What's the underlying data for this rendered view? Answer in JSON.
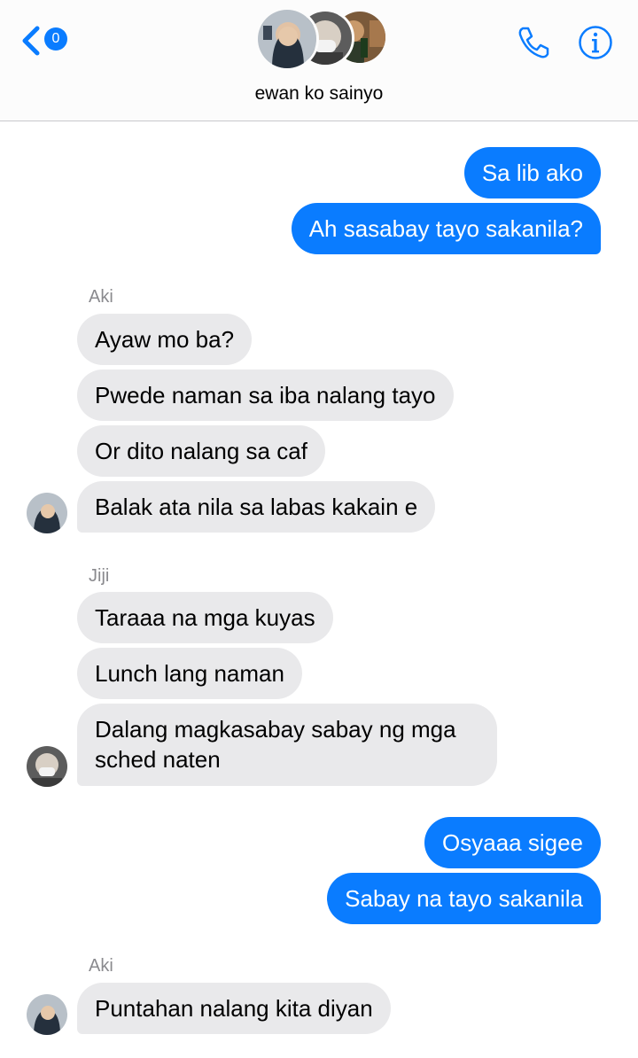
{
  "header": {
    "back_count": "0",
    "title": "ewan ko sainyo"
  },
  "messages": [
    {
      "text": "Sa lib ako"
    },
    {
      "text": "Ah sasabay tayo sakanila?"
    },
    {
      "sender": "Aki"
    },
    {
      "text": "Ayaw mo ba?"
    },
    {
      "text": "Pwede naman sa iba nalang tayo"
    },
    {
      "text": "Or dito nalang sa caf"
    },
    {
      "text": "Balak ata nila sa labas kakain e"
    },
    {
      "sender": "Jiji"
    },
    {
      "text": "Taraaa na mga kuyas"
    },
    {
      "text": "Lunch lang naman"
    },
    {
      "text_line1": "Dalang magkasabay sabay ng mga",
      "text_line2": "sched naten"
    },
    {
      "text": "Osyaaa sigee"
    },
    {
      "text": "Sabay na tayo sakanila"
    },
    {
      "sender": "Aki"
    },
    {
      "text": "Puntahan nalang kita diyan"
    }
  ],
  "colors": {
    "outgoing": "#0a7cff",
    "incoming": "#e9e9eb",
    "accent": "#0a7cff"
  },
  "icons": [
    "back-chevron-icon",
    "phone-icon",
    "info-icon"
  ]
}
